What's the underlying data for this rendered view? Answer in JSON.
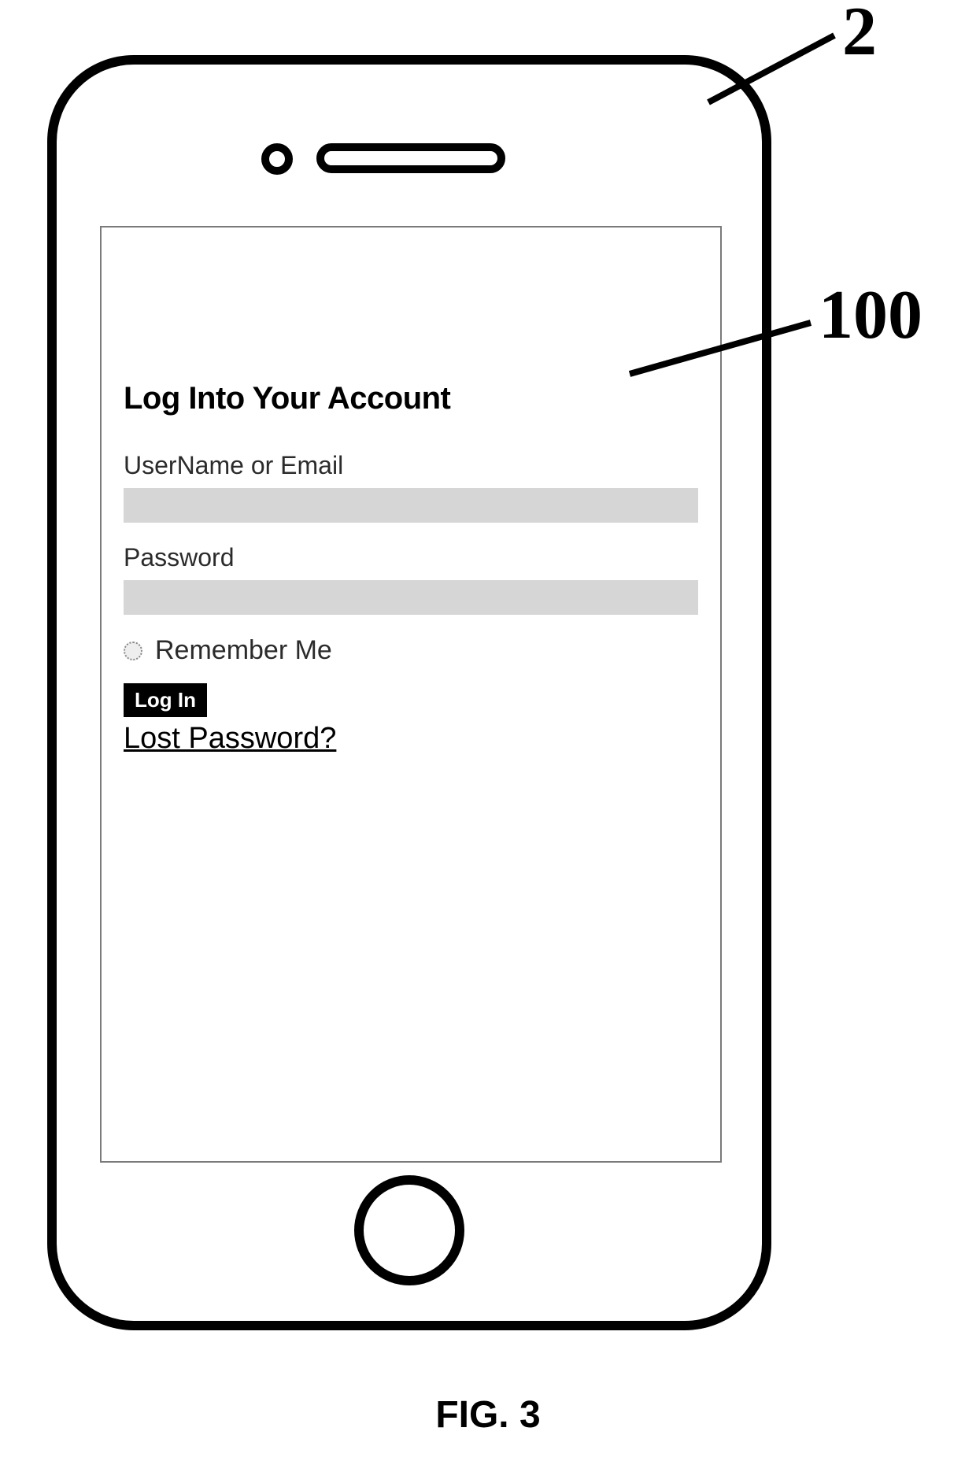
{
  "callouts": {
    "device": "2",
    "screen": "100"
  },
  "form": {
    "heading": "Log Into Your Account",
    "username_label": "UserName or Email",
    "password_label": "Password",
    "remember_label": "Remember Me",
    "login_button": "Log In",
    "lost_password": "Lost Password?"
  },
  "figure_caption": "FIG. 3"
}
